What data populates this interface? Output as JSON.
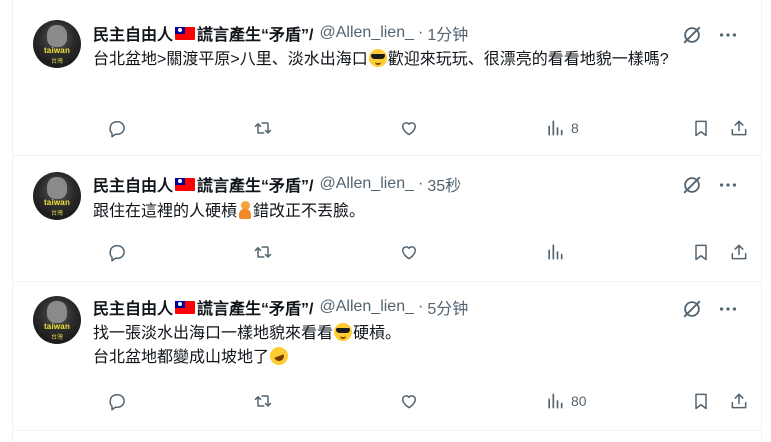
{
  "tweets": [
    {
      "author": {
        "name": "民主自由人",
        "suffix": "謊言產生“矛盾”/",
        "handle": "@Allen_lien_",
        "avatar_text": "taiwan",
        "avatar_sub": "台灣"
      },
      "separator": "·",
      "time": "1分钟",
      "text_a": "台北盆地>關渡平原>八里、淡水出海口",
      "text_b": "歡迎來玩玩、很漂亮的看看地貌一樣嗎?",
      "views": "8"
    },
    {
      "author": {
        "name": "民主自由人",
        "suffix": "謊言產生“矛盾”/",
        "handle": "@Allen_lien_",
        "avatar_text": "taiwan",
        "avatar_sub": "台灣"
      },
      "separator": "·",
      "time": "35秒",
      "text_a": "跟住在這裡的人硬槓",
      "text_b": "錯改正不丟臉。",
      "views": ""
    },
    {
      "author": {
        "name": "民主自由人",
        "suffix": "謊言產生“矛盾”/",
        "handle": "@Allen_lien_",
        "avatar_text": "taiwan",
        "avatar_sub": "台灣"
      },
      "separator": "·",
      "time": "5分钟",
      "text_a": "找一張淡水出海口一樣地貌來看看",
      "text_b": "硬槓。",
      "text_c": "台北盆地都變成山坡地了",
      "views": "80"
    }
  ],
  "icons": {
    "reply": "reply-icon",
    "retweet": "retweet-icon",
    "like": "like-icon",
    "views": "views-icon",
    "bookmark": "bookmark-icon",
    "share": "share-icon",
    "grok": "grok-icon",
    "more": "more-icon"
  },
  "colors": {
    "text": "#0f1419",
    "muted": "#536471",
    "border": "#eff3f4"
  }
}
